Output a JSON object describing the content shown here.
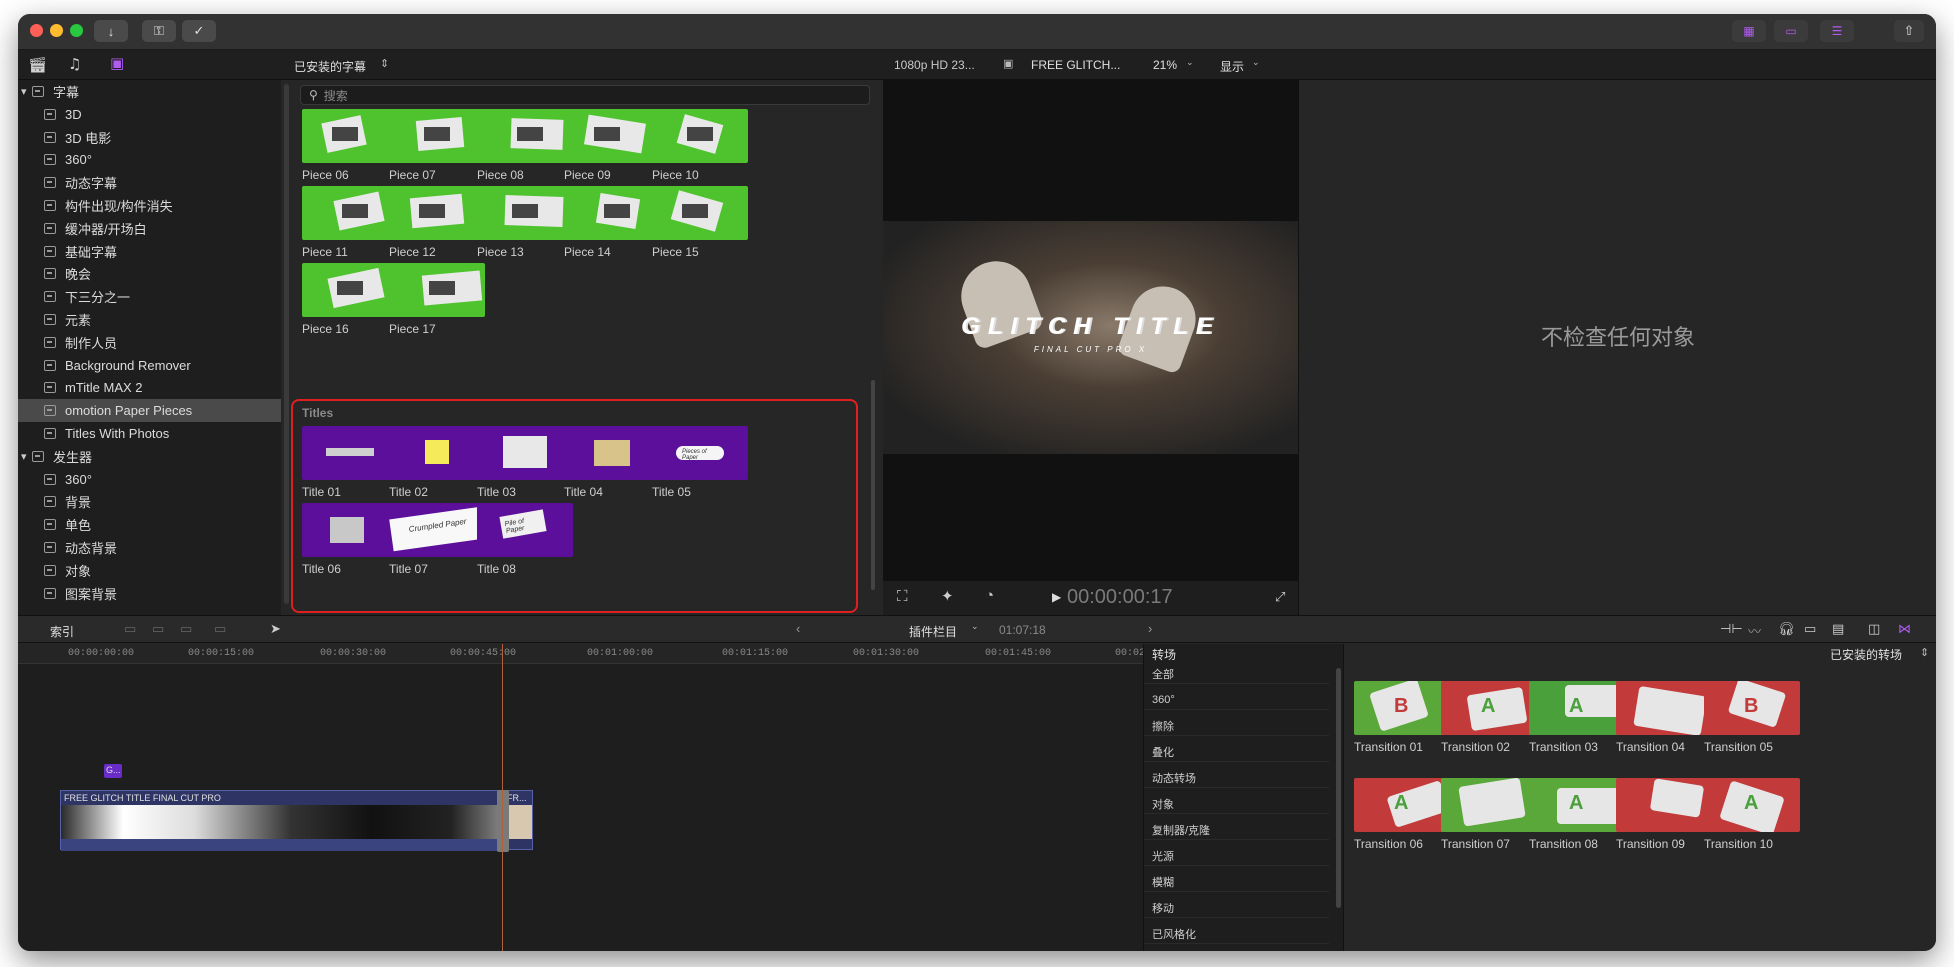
{
  "toolbar": {
    "library_title": "已安装的字幕",
    "search_placeholder": "搜索",
    "viewer_format": "1080p HD 23...",
    "viewer_project": "FREE GLITCH...",
    "zoom": "21%",
    "display_menu": "显示",
    "timecode": "00:00:00:17"
  },
  "sidebar": {
    "titles_group": "字幕",
    "titles": [
      "3D",
      "3D 电影",
      "360°",
      "动态字幕",
      "构件出现/构件消失",
      "缓冲器/开场白",
      "基础字幕",
      "晚会",
      "下三分之一",
      "元素",
      "制作人员",
      "Background Remover",
      "mTitle MAX 2",
      "omotion Paper Pieces",
      "Titles With Photos"
    ],
    "selected": "omotion Paper Pieces",
    "generators_group": "发生器",
    "generators": [
      "360°",
      "背景",
      "单色",
      "动态背景",
      "对象",
      "图案背景"
    ]
  },
  "browser": {
    "pieces": [
      "Piece 06",
      "Piece 07",
      "Piece 08",
      "Piece 09",
      "Piece 10",
      "Piece 11",
      "Piece 12",
      "Piece 13",
      "Piece 14",
      "Piece 15",
      "Piece 16",
      "Piece 17"
    ],
    "titles_section": "Titles",
    "titles": [
      "Title 01",
      "Title 02",
      "Title 03",
      "Title 04",
      "Title 05",
      "Title 06",
      "Title 07",
      "Title 08"
    ],
    "title07_text": "Crumpled Paper",
    "title08_text": "Pile of Paper",
    "title05_text": "Pieces of Paper"
  },
  "viewer": {
    "glitch_title": "GLITCH TITLE",
    "glitch_sub": "FINAL CUT PRO X"
  },
  "inspector": {
    "empty_text": "不检查任何对象"
  },
  "timeline_bar": {
    "index_label": "索引",
    "plugin_column": "插件栏目",
    "duration": "01:07:18"
  },
  "timeline": {
    "ruler": [
      "00:00:00:00",
      "00:00:15:00",
      "00:00:30:00",
      "00:00:45:00",
      "00:01:00:00",
      "00:01:15:00",
      "00:01:30:00",
      "00:01:45:00",
      "00:02"
    ],
    "title_clip": "G...",
    "main_clip": "FREE GLITCH TITLE  FINAL CUT PRO",
    "second_clip": "FR..."
  },
  "transitions": {
    "header": "转场",
    "installed": "已安装的转场",
    "categories": [
      "全部",
      "360°",
      "擦除",
      "叠化",
      "动态转场",
      "对象",
      "复制器/克隆",
      "光源",
      "模糊",
      "移动",
      "已风格化"
    ],
    "items": [
      "Transition 01",
      "Transition 02",
      "Transition 03",
      "Transition 04",
      "Transition 05",
      "Transition 06",
      "Transition 07",
      "Transition 08",
      "Transition 09",
      "Transition 10"
    ]
  },
  "colors": {
    "accent_purple": "#5b0f9b",
    "green_screen": "#4ec32d",
    "highlight_red": "#e02020"
  }
}
